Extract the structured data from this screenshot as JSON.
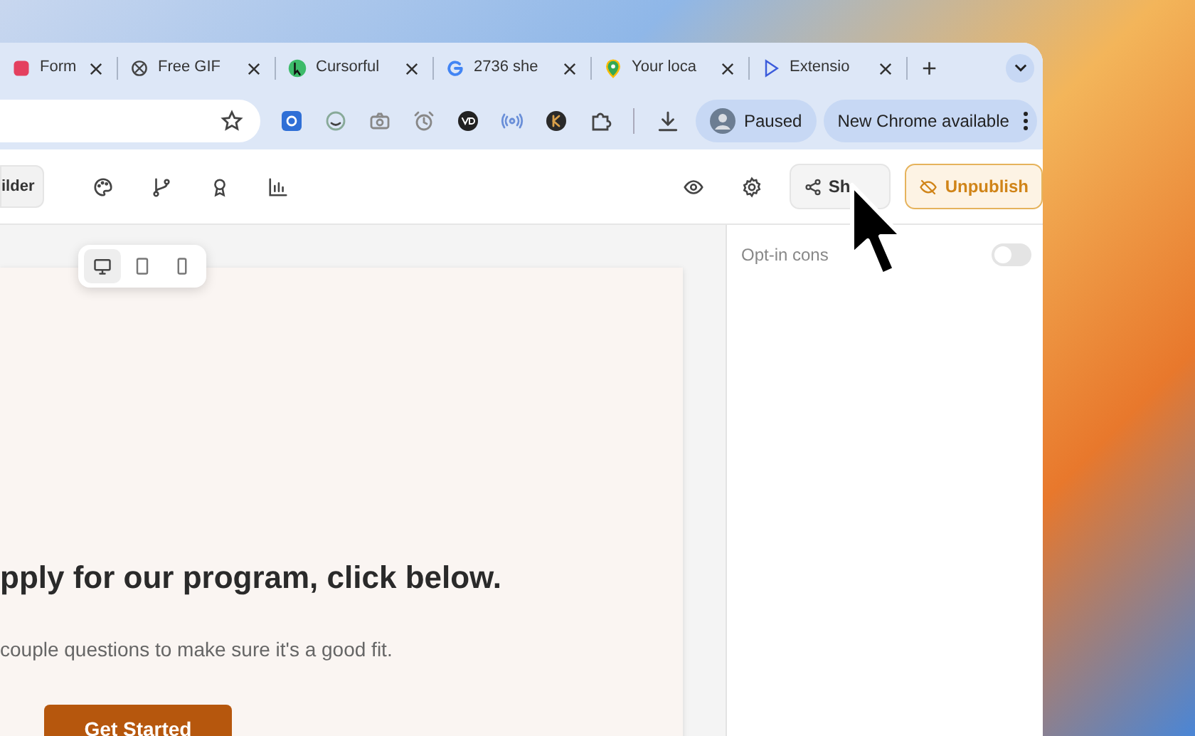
{
  "browser": {
    "tabs": [
      {
        "label": "Form",
        "selected": false
      },
      {
        "label": "Free GIF",
        "selected": false
      },
      {
        "label": "Cursorful",
        "selected": false
      },
      {
        "label": "2736 she",
        "selected": false
      },
      {
        "label": "Your loca",
        "selected": false
      },
      {
        "label": "Extensio",
        "selected": false
      }
    ],
    "new_tab": "+",
    "profile": {
      "label": "Paused"
    },
    "update": {
      "label": "New Chrome available"
    }
  },
  "app_toolbar": {
    "builder_button": "ilder",
    "share_button": "Sh",
    "unpublish_button": "Unpublish"
  },
  "preview": {
    "devices": [
      {
        "kind": "desktop",
        "selected": true
      },
      {
        "kind": "tablet",
        "selected": false
      },
      {
        "kind": "phone",
        "selected": false
      }
    ],
    "heading": "pply for our program, click below.",
    "subtitle": "couple questions to make sure it's a good fit.",
    "cta": "Get Started"
  },
  "settings": {
    "label": "Opt-in cons",
    "on": false
  }
}
